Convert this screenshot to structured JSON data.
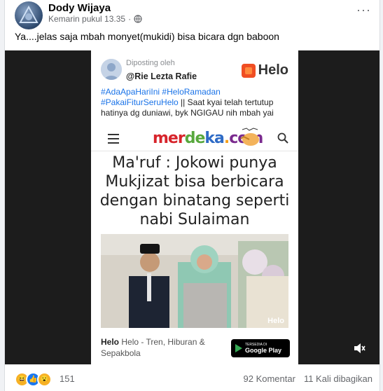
{
  "post": {
    "author": "Dody Wijaya",
    "timestamp": "Kemarin pukul 13.35",
    "audience_icon": "globe-icon",
    "more_label": "···",
    "text": "Ya....jelas saja mbah monyet(mukidi) bisa bicara dgn baboon"
  },
  "media": {
    "posted_by": "Diposting oleh",
    "handle": "@Rie Lezta Rafie",
    "helo_logo": "Helo",
    "caption": {
      "tag1": "#AdaApaHariIni",
      "tag2": "#HeloRamadan",
      "tag3": "#PakaiFiturSeruHelo",
      "text": " || Saat kyai telah tertutup hatinya dg duniawi, byk NGIGAU nih mbah yai"
    },
    "site": {
      "p1": "mer",
      "p2": "de",
      "p3": "ka",
      "p4": ".",
      "p5": "com"
    },
    "headline": "Ma'ruf : Jokowi punya Mukjizat bisa berbicara dengan binatang seperti nabi Sulaiman",
    "photo_watermark": "Helo",
    "footer_brand": "Helo",
    "footer_text": " Helo - Tren, Hiburan & Sepakbola",
    "gplay_small": "TERSEDIA DI",
    "gplay_big": "Google Play"
  },
  "stats": {
    "reaction_count": "151",
    "comments": "92 Komentar",
    "shares": "11 Kali dibagikan"
  }
}
